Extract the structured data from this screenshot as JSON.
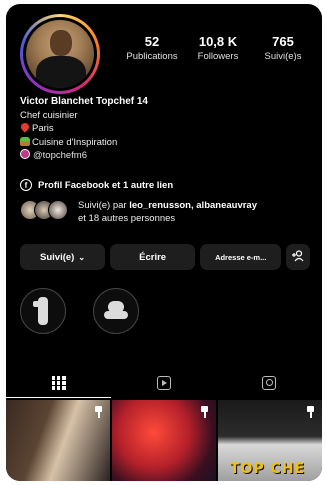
{
  "profile": {
    "name": "Victor Blanchet Topchef 14",
    "category": "Chef cuisinier",
    "location": "Paris",
    "tagline": "Cuisine d'Inspiration",
    "threads_handle": "@topchefm6"
  },
  "stats": {
    "posts_count": "52",
    "posts_label": "Publications",
    "followers_count": "10,8 K",
    "followers_label": "Followers",
    "following_count": "765",
    "following_label": "Suivi(e)s"
  },
  "links": {
    "facebook_label": "Profil Facebook et 1 autre lien"
  },
  "mutual": {
    "prefix": "Suivi(e) par",
    "names": "leo_renusson, albaneauvray",
    "suffix": "et 18 autres personnes"
  },
  "actions": {
    "follow_label": "Suivi(e)",
    "write_label": "Écrire",
    "email_label": "Adresse e-m...",
    "add_label": "+"
  },
  "tabs": [
    "grid-icon",
    "reels-icon",
    "tagged-icon"
  ],
  "posts": [
    {
      "pinned": true
    },
    {
      "pinned": true
    },
    {
      "pinned": true,
      "overlay_text": "TOP CHE"
    }
  ],
  "colors": {
    "background": "#000000",
    "text": "#ffffff",
    "button_bg": "#1e1e1e",
    "top_chef_yellow": "#f2c200"
  }
}
